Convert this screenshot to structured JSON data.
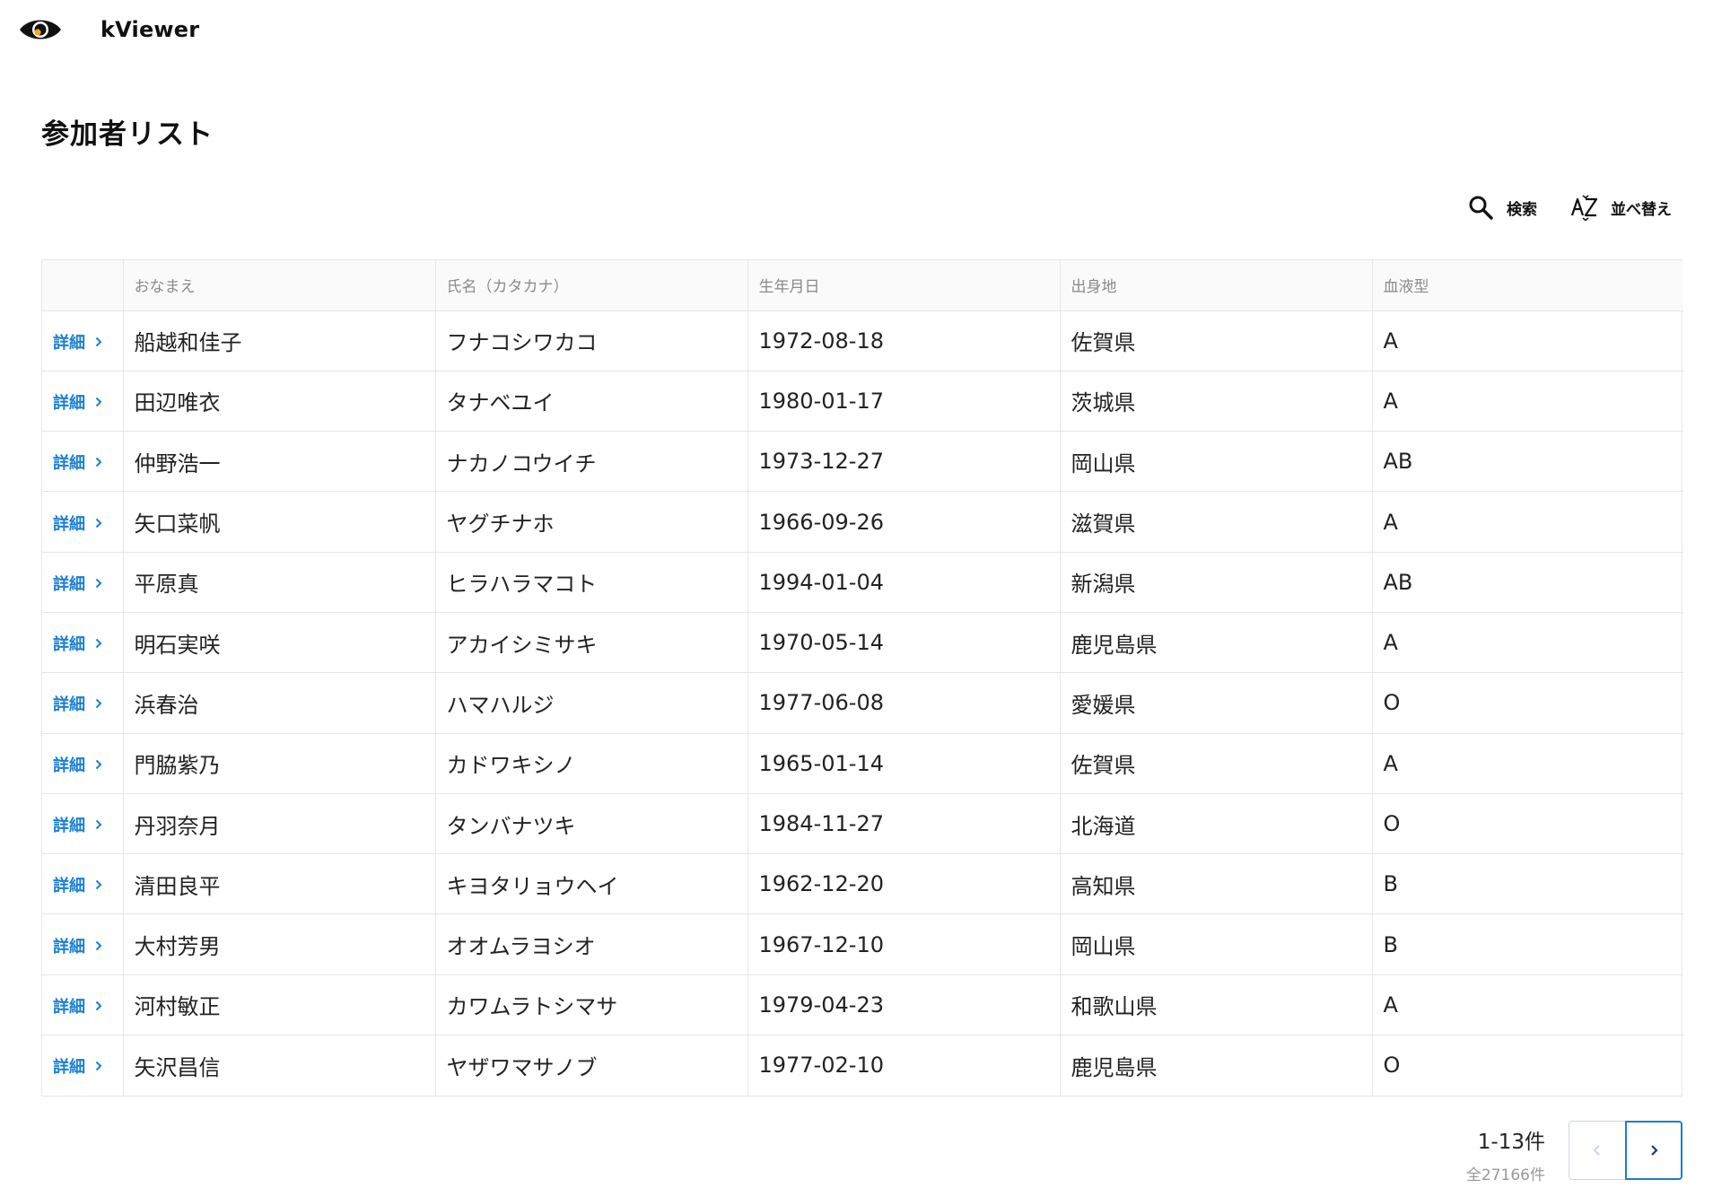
{
  "app": {
    "title": "kViewer"
  },
  "page": {
    "title": "参加者リスト"
  },
  "toolbar": {
    "search_label": "検索",
    "sort_label": "並べ替え"
  },
  "table": {
    "columns": [
      "",
      "おなまえ",
      "氏名（カタカナ）",
      "生年月日",
      "出身地",
      "血液型"
    ],
    "detail_label": "詳細",
    "rows": [
      {
        "name": "船越和佳子",
        "kana": "フナコシワカコ",
        "birthdate": "1972-08-18",
        "origin": "佐賀県",
        "blood": "A"
      },
      {
        "name": "田辺唯衣",
        "kana": "タナベユイ",
        "birthdate": "1980-01-17",
        "origin": "茨城県",
        "blood": "A"
      },
      {
        "name": "仲野浩一",
        "kana": "ナカノコウイチ",
        "birthdate": "1973-12-27",
        "origin": "岡山県",
        "blood": "AB"
      },
      {
        "name": "矢口菜帆",
        "kana": "ヤグチナホ",
        "birthdate": "1966-09-26",
        "origin": "滋賀県",
        "blood": "A"
      },
      {
        "name": "平原真",
        "kana": "ヒラハラマコト",
        "birthdate": "1994-01-04",
        "origin": "新潟県",
        "blood": "AB"
      },
      {
        "name": "明石実咲",
        "kana": "アカイシミサキ",
        "birthdate": "1970-05-14",
        "origin": "鹿児島県",
        "blood": "A"
      },
      {
        "name": "浜春治",
        "kana": "ハマハルジ",
        "birthdate": "1977-06-08",
        "origin": "愛媛県",
        "blood": "O"
      },
      {
        "name": "門脇紫乃",
        "kana": "カドワキシノ",
        "birthdate": "1965-01-14",
        "origin": "佐賀県",
        "blood": "A"
      },
      {
        "name": "丹羽奈月",
        "kana": "タンバナツキ",
        "birthdate": "1984-11-27",
        "origin": "北海道",
        "blood": "O"
      },
      {
        "name": "清田良平",
        "kana": "キヨタリョウヘイ",
        "birthdate": "1962-12-20",
        "origin": "高知県",
        "blood": "B"
      },
      {
        "name": "大村芳男",
        "kana": "オオムラヨシオ",
        "birthdate": "1967-12-10",
        "origin": "岡山県",
        "blood": "B"
      },
      {
        "name": "河村敏正",
        "kana": "カワムラトシマサ",
        "birthdate": "1979-04-23",
        "origin": "和歌山県",
        "blood": "A"
      },
      {
        "name": "矢沢昌信",
        "kana": "ヤザワマサノブ",
        "birthdate": "1977-02-10",
        "origin": "鹿児島県",
        "blood": "O"
      }
    ]
  },
  "pagination": {
    "range": "1-13件",
    "total": "全27166件"
  },
  "colors": {
    "accent": "#1a7fd4",
    "logo_iris": "#f5a623",
    "border": "#e6e6e6",
    "header_bg": "#fafafa"
  },
  "icons": {
    "logo": "eye-icon",
    "search": "search-icon",
    "sort": "sort-az-icon",
    "detail": "chevron-right-icon",
    "prev": "chevron-left-icon",
    "next": "chevron-right-icon"
  }
}
